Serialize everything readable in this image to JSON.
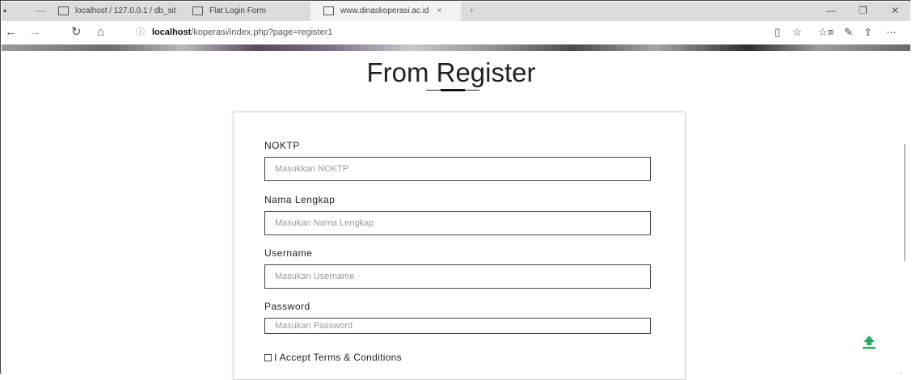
{
  "browser": {
    "tabs": [
      {
        "label": "localhost / 127.0.0.1 / db_sit"
      },
      {
        "label": "Flat Login Form"
      },
      {
        "label": "www.dinaskoperasi.ac.id"
      }
    ],
    "url_host": "localhost",
    "url_path": "/koperasi/index.php?page=register1"
  },
  "page": {
    "title": "From Register"
  },
  "form": {
    "noktp_label": "NOKTP",
    "noktp_placeholder": "Masukkan NOKTP",
    "nama_label": "Nama Lengkap",
    "nama_placeholder": "Masukan Nama Lengkap",
    "username_label": "Username",
    "username_placeholder": "Masukan Username",
    "password_label": "Password",
    "password_placeholder": "Masukan Password",
    "terms_label": "I Accept Terms & Conditions"
  },
  "colors": {
    "accent_icon": "#27ae60"
  }
}
